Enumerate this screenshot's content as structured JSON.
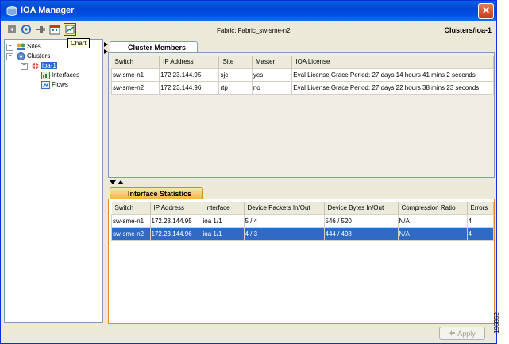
{
  "window": {
    "title": "IOA Manager",
    "close_glyph": "✕"
  },
  "toolbar": {
    "icons": [
      "back-icon",
      "refresh-icon",
      "connect-icon",
      "calendar-icon",
      "chart-icon"
    ],
    "tooltip": "Chart"
  },
  "header": {
    "fabric": "Fabric: Fabric_sw-sme-n2",
    "breadcrumb": "Clusters/ioa-1"
  },
  "tree": {
    "items": [
      {
        "label": "Sites",
        "expander": "+"
      },
      {
        "label": "Clusters",
        "expander": "−"
      },
      {
        "label": "ioa-1",
        "expander": "−",
        "selected": true
      },
      {
        "label": "Interfaces"
      },
      {
        "label": "Flows"
      }
    ]
  },
  "members": {
    "tab": "Cluster Members",
    "columns": [
      "Switch",
      "IP Address",
      "Site",
      "Master",
      "IOA License"
    ],
    "rows": [
      [
        "sw-sme-n1",
        "172.23.144.95",
        "sjc",
        "yes",
        "Eval License Grace Period: 27 days 14 hours 41 mins 2 seconds"
      ],
      [
        "sw-sme-n2",
        "172.23.144.96",
        "rtp",
        "no",
        "Eval License Grace Period: 27 days 22 hours 38 mins 23 seconds"
      ]
    ]
  },
  "stats": {
    "tab": "Interface Statistics",
    "columns": [
      "Switch",
      "IP Address",
      "Interface",
      "Device Packets In/Out",
      "Device Bytes In/Out",
      "Compression Ratio",
      "Errors"
    ],
    "rows": [
      [
        "sw-sme-n1",
        "172.23.144.95",
        "ioa 1/1",
        "5 / 4",
        "546 / 520",
        "N/A",
        "4"
      ],
      [
        "sw-sme-n2",
        "172.23.144.96",
        "ioa 1/1",
        "4 / 3",
        "444 / 498",
        "N/A",
        "4"
      ]
    ],
    "selected_row": 1
  },
  "footer": {
    "apply": "Apply"
  },
  "figure_id": "196862",
  "colors": {
    "title_bar": "#0050e6",
    "selection": "#316ac5",
    "stats_accent": "#f6b23a"
  }
}
